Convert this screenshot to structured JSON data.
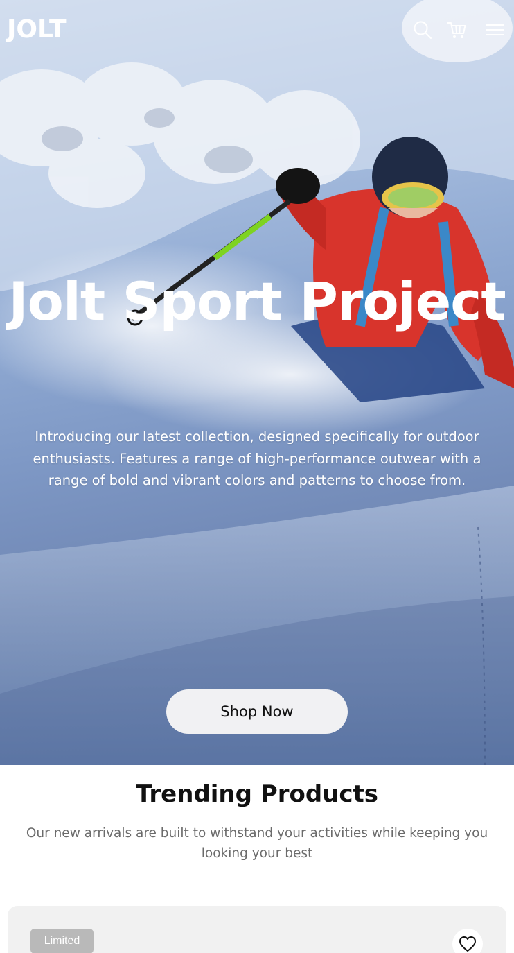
{
  "header": {
    "logo": "JOLT",
    "icons": [
      "search-icon",
      "cart-icon",
      "menu-icon"
    ]
  },
  "hero": {
    "title": "Jolt Sport Project",
    "description": "Introducing our latest collection, designed specifically for outdoor enthusiasts. Features a range of high-performance outwear with a range of bold and vibrant colors and patterns to choose from.",
    "cta_label": "Shop Now"
  },
  "trending": {
    "title": "Trending Products",
    "subtitle": "Our new arrivals are built to withstand your activities while keeping you looking your best",
    "products": [
      {
        "badge": "Limited",
        "wishlist_icon": "heart-icon"
      }
    ]
  },
  "colors": {
    "cta_background": "#f1f1f3",
    "card_background": "#f1f1f1",
    "badge_background": "#b9b9b9",
    "skier_jacket": "#d8342c"
  }
}
